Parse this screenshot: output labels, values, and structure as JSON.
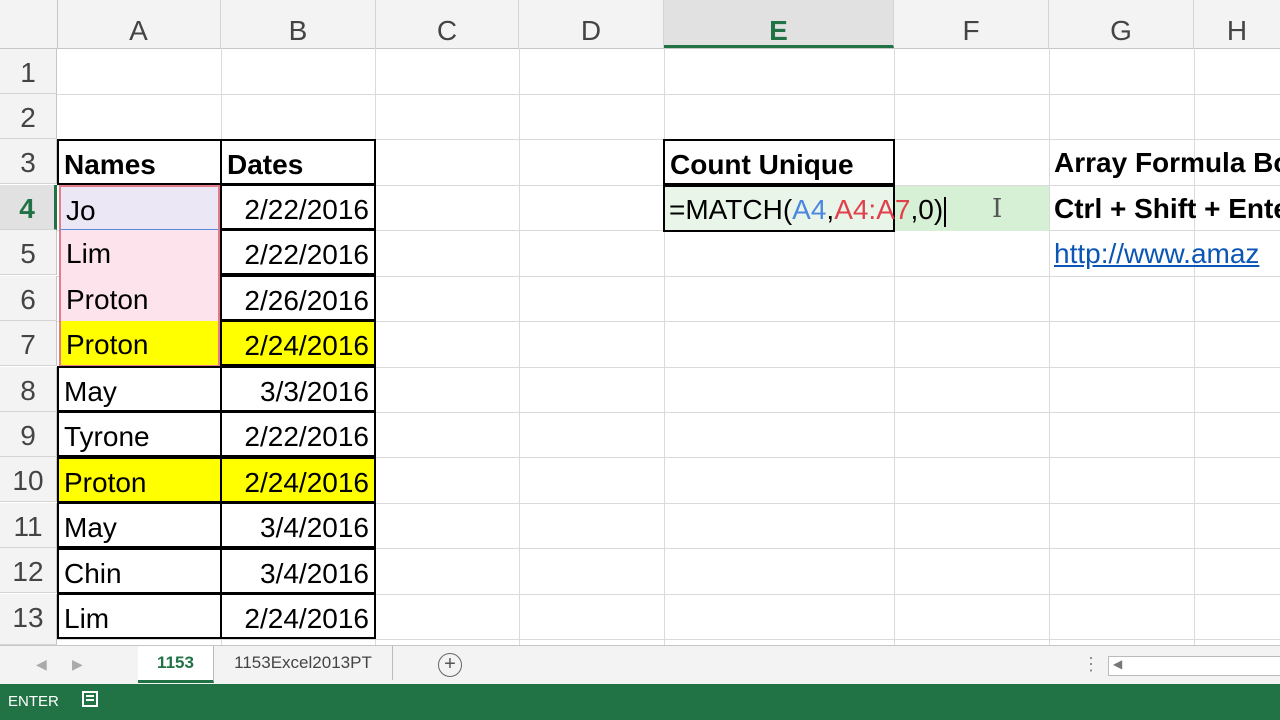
{
  "columns": [
    "A",
    "B",
    "C",
    "D",
    "E",
    "F",
    "G",
    "H"
  ],
  "active_column": "E",
  "rows": [
    "1",
    "2",
    "3",
    "4",
    "5",
    "6",
    "7",
    "8",
    "9",
    "10",
    "11",
    "12",
    "13"
  ],
  "active_row": "4",
  "table": {
    "header_names": "Names",
    "header_dates": "Dates",
    "data": [
      {
        "name": "Jo",
        "date": "2/22/2016",
        "highlight": "none"
      },
      {
        "name": "Lim",
        "date": "2/22/2016",
        "highlight": "none"
      },
      {
        "name": "Proton",
        "date": "2/26/2016",
        "highlight": "none"
      },
      {
        "name": "Proton",
        "date": "2/24/2016",
        "highlight": "yellow"
      },
      {
        "name": "May",
        "date": "3/3/2016",
        "highlight": "none"
      },
      {
        "name": "Tyrone",
        "date": "2/22/2016",
        "highlight": "none"
      },
      {
        "name": "Proton",
        "date": "2/24/2016",
        "highlight": "yellow"
      },
      {
        "name": "May",
        "date": "3/4/2016",
        "highlight": "none"
      },
      {
        "name": "Chin",
        "date": "3/4/2016",
        "highlight": "none"
      },
      {
        "name": "Lim",
        "date": "2/24/2016",
        "highlight": "none"
      }
    ]
  },
  "count_unique": {
    "label": "Count Unique",
    "formula_prefix": "=MATCH(",
    "formula_ref1": "A4",
    "formula_comma1": ",",
    "formula_ref2": "A4:A7",
    "formula_suffix": ",0)"
  },
  "notes": {
    "line1": "Array Formula Bo",
    "line2": "Ctrl + Shift + Ente",
    "link": "http://www.amaz"
  },
  "sheet_tabs": [
    "1153",
    "1153Excel2013PT"
  ],
  "active_tab": "1153",
  "status": {
    "mode": "ENTER"
  },
  "colors": {
    "excel_green": "#217346",
    "highlight_yellow": "#ffff00",
    "ref_blue": "#4b86e0",
    "ref_red": "#e0404a"
  },
  "icons": [
    "nav-left-icon",
    "nav-right-icon",
    "add-sheet-icon",
    "macro-record-icon",
    "text-cursor-icon"
  ]
}
